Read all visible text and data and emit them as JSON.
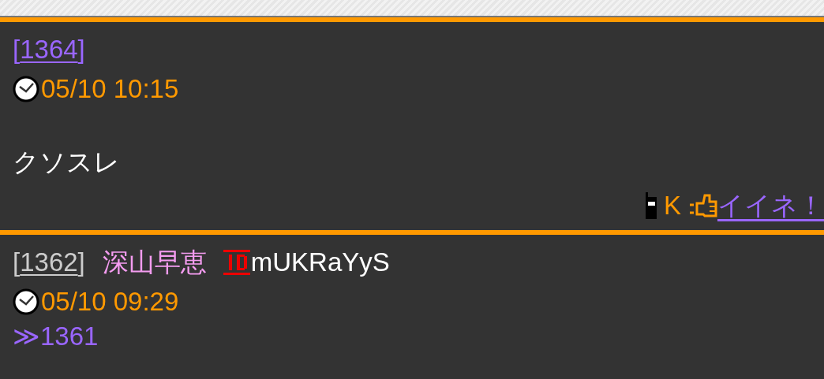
{
  "posts": [
    {
      "number": "[1364]",
      "visited": false,
      "time": "05/10 10:15",
      "body": "クソスレ",
      "footer": {
        "device": "K",
        "like": "イイネ！"
      }
    },
    {
      "number": "[1362]",
      "visited": true,
      "name": "深山早恵",
      "id": "mUKRaYyS",
      "time": "05/10 09:29",
      "anchor": "≫1361"
    }
  ]
}
